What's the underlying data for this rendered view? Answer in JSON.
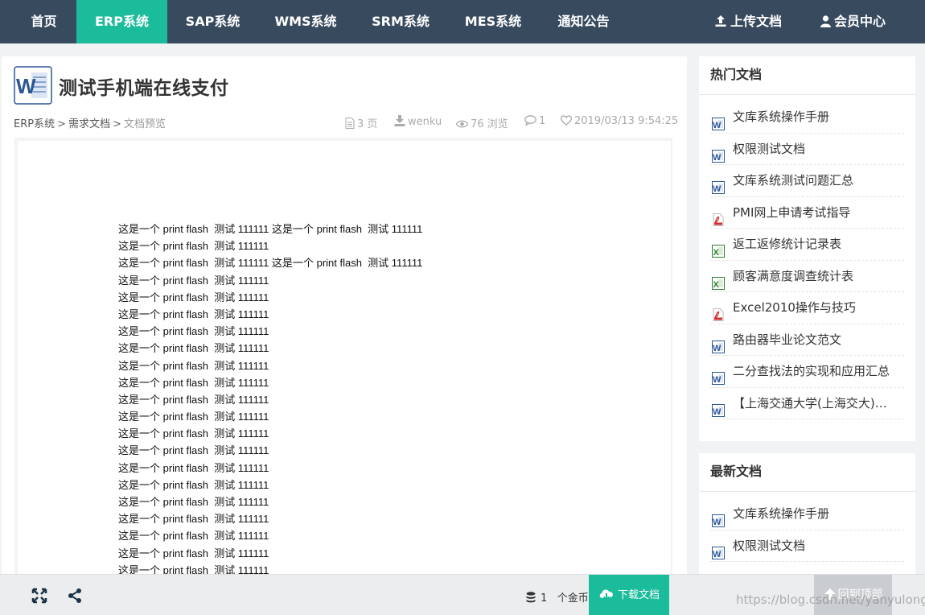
{
  "nav": {
    "items": [
      "首页",
      "ERP系统",
      "SAP系统",
      "WMS系统",
      "SRM系统",
      "MES系统",
      "通知公告"
    ],
    "active_index": 1,
    "upload_label": "上传文档",
    "member_label": "会员中心"
  },
  "doc": {
    "title": "测试手机端在线支付",
    "breadcrumb": [
      "ERP系统",
      "需求文档",
      "文档预览"
    ],
    "breadcrumb_sep": ">",
    "meta": {
      "pages": "3 页",
      "author": "wenku",
      "views": "76 浏览",
      "comments": "1",
      "date": "2019/03/13 9:54:25"
    },
    "content_lines": [
      "这是一个 print flash  测试 111111 这是一个 print flash  测试 111111",
      "这是一个 print flash  测试 111111",
      "这是一个 print flash  测试 111111 这是一个 print flash  测试 111111",
      "这是一个 print flash  测试 111111",
      "这是一个 print flash  测试 111111",
      "这是一个 print flash  测试 111111",
      "这是一个 print flash  测试 111111",
      "这是一个 print flash  测试 111111",
      "这是一个 print flash  测试 111111",
      "这是一个 print flash  测试 111111",
      "这是一个 print flash  测试 111111",
      "这是一个 print flash  测试 111111",
      "这是一个 print flash  测试 111111",
      "这是一个 print flash  测试 111111",
      "这是一个 print flash  测试 111111",
      "这是一个 print flash  测试 111111",
      "这是一个 print flash  测试 111111",
      "这是一个 print flash  测试 111111",
      "这是一个 print flash  测试 111111",
      "这是一个 print flash  测试 111111",
      "这是一个 print flash  测试 111111"
    ]
  },
  "sidebar": {
    "hot": {
      "title": "热门文档",
      "items": [
        {
          "label": "文库系统操作手册",
          "icon": "word-icon"
        },
        {
          "label": "权限测试文档",
          "icon": "word-icon"
        },
        {
          "label": "文库系统测试问题汇总",
          "icon": "word-icon"
        },
        {
          "label": "PMI网上申请考试指导",
          "icon": "pdf-icon"
        },
        {
          "label": "返工返修统计记录表",
          "icon": "excel-icon"
        },
        {
          "label": "顾客满意度调查统计表",
          "icon": "excel-icon"
        },
        {
          "label": "Excel2010操作与技巧",
          "icon": "pdf-icon"
        },
        {
          "label": "路由器毕业论文范文",
          "icon": "word-icon"
        },
        {
          "label": "二分查找法的实现和应用汇总",
          "icon": "word-icon"
        },
        {
          "label": "【上海交通大学(上海交大)…",
          "icon": "word-icon"
        }
      ]
    },
    "latest": {
      "title": "最新文档",
      "items": [
        {
          "label": "文库系统操作手册",
          "icon": "word-icon"
        },
        {
          "label": "权限测试文档",
          "icon": "word-icon"
        }
      ]
    }
  },
  "bottombar": {
    "coins_value": "1",
    "coins_unit": "个金币",
    "download_label": "下载文档",
    "backtop_label": "回到顶部",
    "watermark": "https://blog.csdn.net/yanyulong0"
  },
  "colors": {
    "nav_bg": "#384a5e",
    "accent": "#1bbc9b",
    "word_blue": "#2b5797",
    "excel_green": "#2e7d32",
    "pdf_red": "#d32f2f"
  }
}
